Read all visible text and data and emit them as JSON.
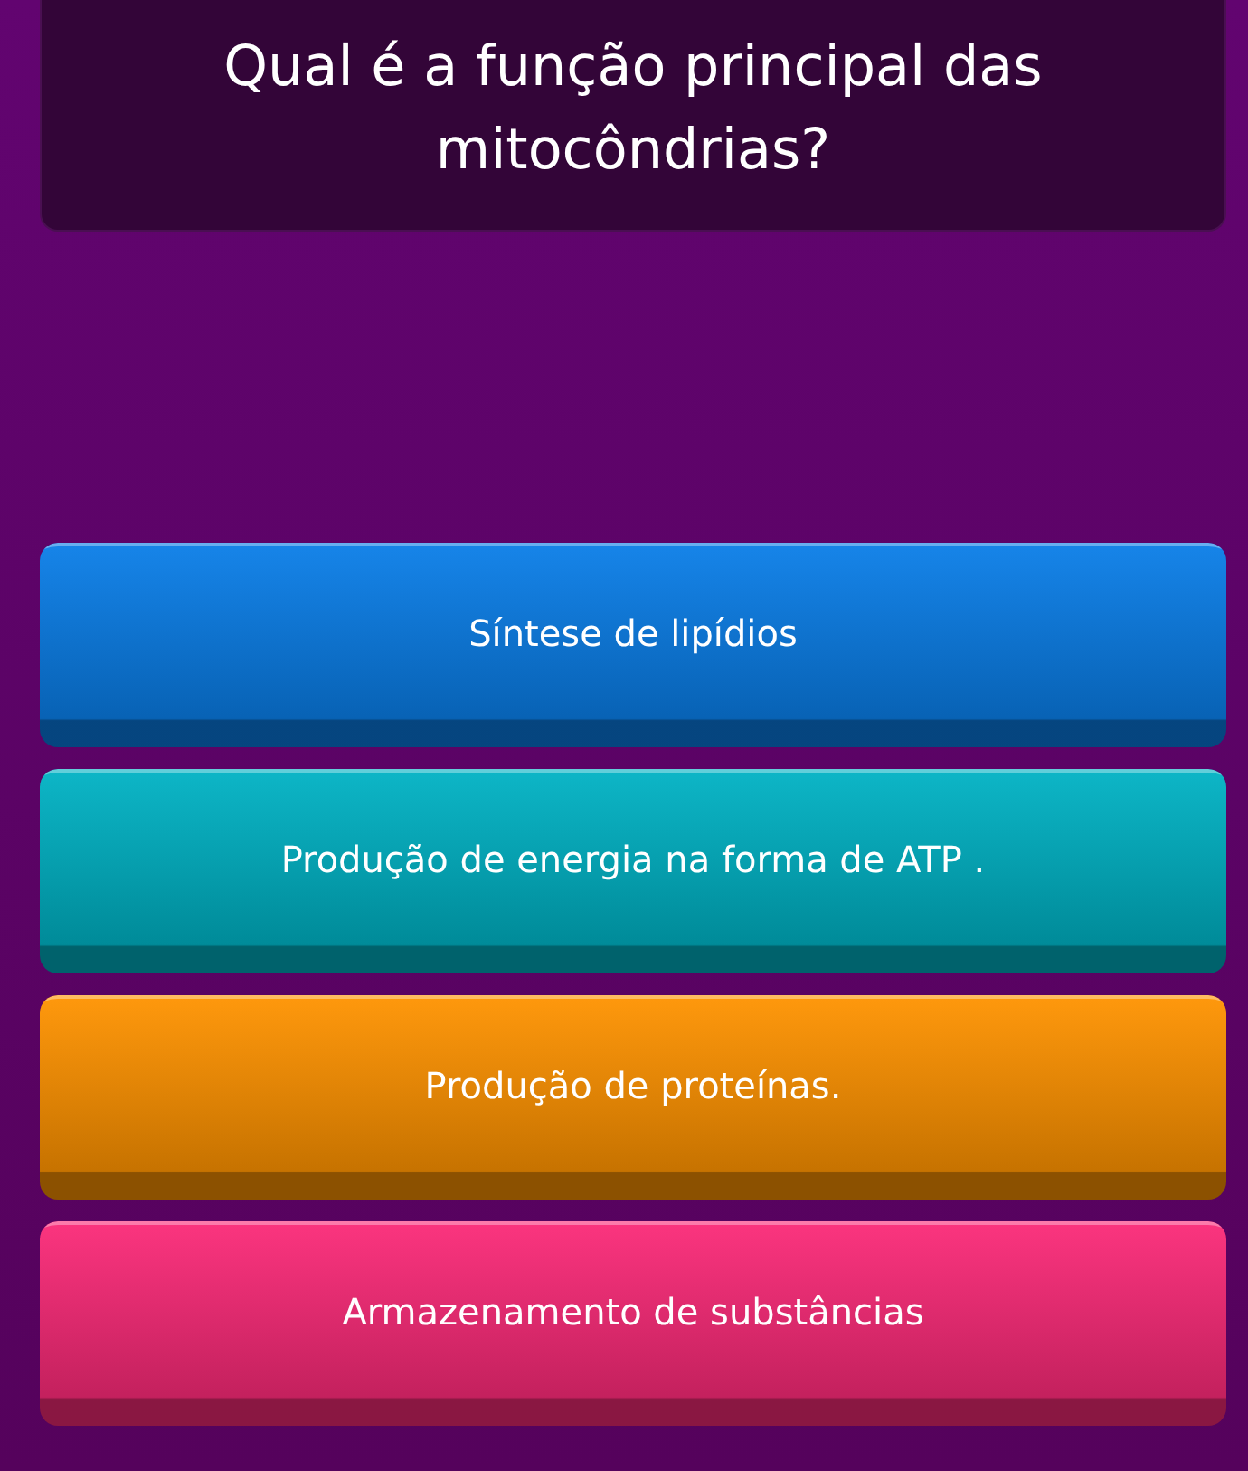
{
  "question": "Qual é a função principal das mitocôndrias?",
  "options": [
    {
      "label": "Síntese de lipídios",
      "color": "#0a7ee8"
    },
    {
      "label": "Produção de energia na forma de ATP .",
      "color": "#00b2c4"
    },
    {
      "label": "Produção de proteínas.",
      "color": "#ff9300"
    },
    {
      "label": "Armazenamento de substâncias",
      "color": "#fb2a78"
    }
  ]
}
